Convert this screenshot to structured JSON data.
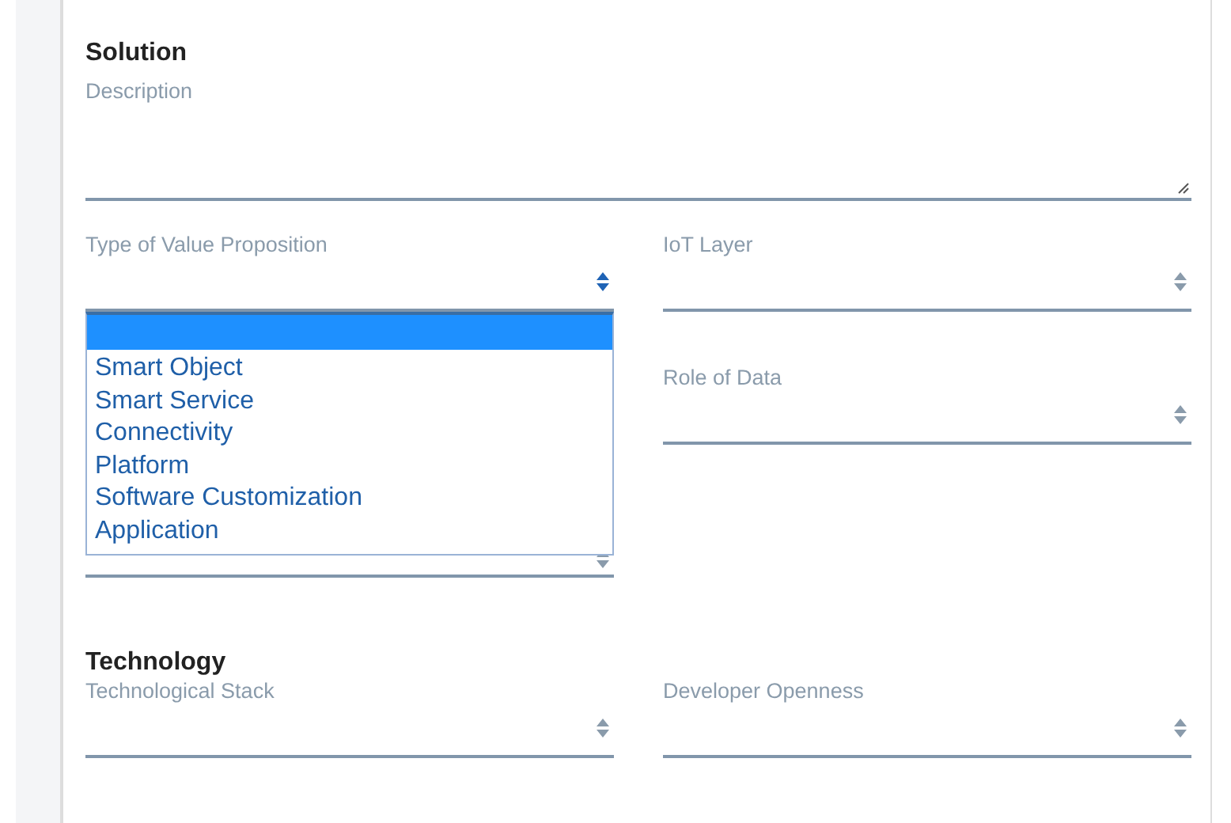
{
  "sections": [
    {
      "title": "Solution",
      "description": {
        "label": "Description"
      },
      "columns": [
        [
          {
            "label": "Type of Value Proposition",
            "open": true,
            "options": [
              {
                "selected": true
              },
              {
                "label": "Smart Object",
                "selected": false
              },
              {
                "label": "Smart Service",
                "selected": false
              },
              {
                "label": "Connectivity",
                "selected": false
              },
              {
                "label": "Platform",
                "selected": false
              },
              {
                "label": "Software Customization",
                "selected": false
              },
              {
                "label": "Application",
                "selected": false
              }
            ]
          },
          {
            "open": false
          }
        ],
        [
          {
            "label": "IoT Layer",
            "open": false
          },
          {
            "label": "Role of Data",
            "open": false
          }
        ]
      ]
    },
    {
      "title": "Technology",
      "columns": [
        [
          {
            "label": "Technological Stack",
            "open": false
          }
        ],
        [
          {
            "label": "Developer Openness",
            "open": false
          }
        ]
      ]
    }
  ]
}
